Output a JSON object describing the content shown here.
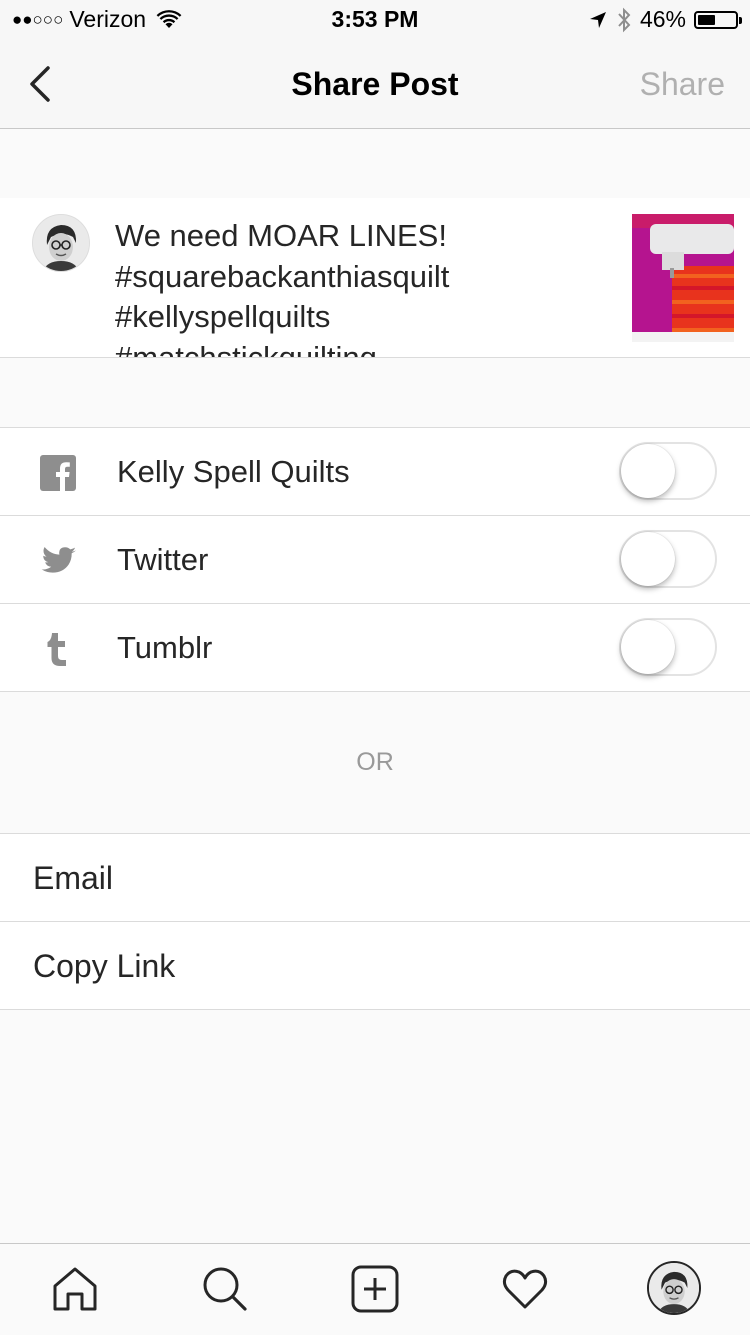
{
  "status_bar": {
    "signal_dots": "●●○○○",
    "carrier": "Verizon",
    "time": "3:53 PM",
    "battery_percent": "46%",
    "battery_level": 0.46
  },
  "nav": {
    "title": "Share Post",
    "share_label": "Share"
  },
  "post": {
    "caption": "We need MOAR LINES!\n#squarebackanthiasquilt\n#kellyspellquilts\n#matchstickquilting"
  },
  "share_targets": [
    {
      "label": "Kelly Spell Quilts",
      "icon": "facebook-icon",
      "enabled": false
    },
    {
      "label": "Twitter",
      "icon": "twitter-icon",
      "enabled": false
    },
    {
      "label": "Tumblr",
      "icon": "tumblr-icon",
      "enabled": false
    }
  ],
  "or_label": "OR",
  "actions": [
    {
      "label": "Email"
    },
    {
      "label": "Copy Link"
    }
  ],
  "tab_bar": {
    "icons": [
      "home-icon",
      "search-icon",
      "add-icon",
      "heart-icon",
      "profile-avatar"
    ]
  },
  "colors": {
    "share_disabled": "#b0b0b0",
    "icon_gray": "#8e8e8e"
  }
}
